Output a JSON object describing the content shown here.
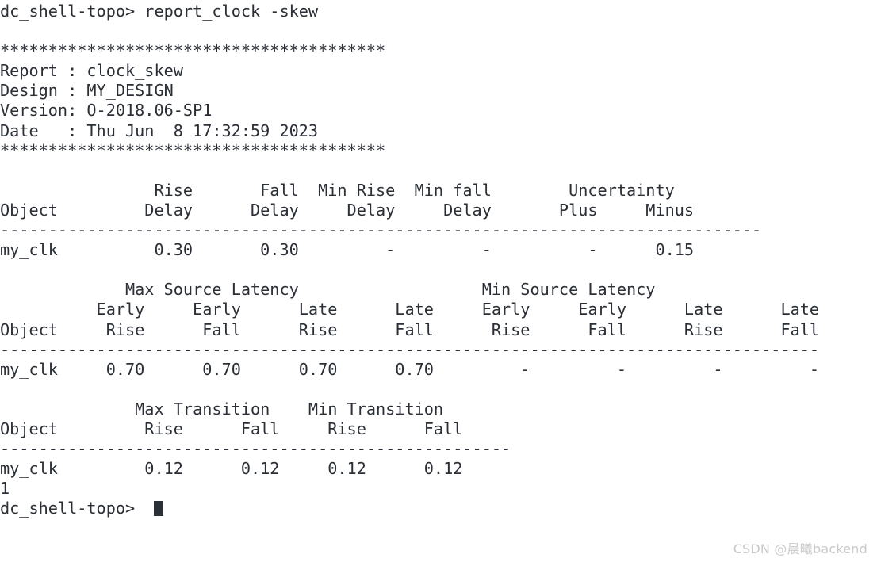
{
  "terminal": {
    "prompt": "dc_shell-topo> ",
    "command": "report_clock -skew",
    "separator": "****************************************",
    "report_header": {
      "report_label": "Report : ",
      "report_value": "clock_skew",
      "design_label": "Design : ",
      "design_value": "MY_DESIGN",
      "version_label": "Version: ",
      "version_value": "O-2018.06-SP1",
      "date_label": "Date   : ",
      "date_value": "Thu Jun  8 17:32:59 2023"
    },
    "table1": {
      "group_header_row": "               Rise        Fall  Min Rise  Min fall       Uncertainty",
      "header_row1": "               Rise        Fall  Min Rise  Min fall       Uncertainty",
      "header_row2": "Object        Delay       Delay     Delay     Delay      Plus     Minus",
      "divider": "------------------------------------------------------------------------------",
      "data_row": "my_clk         0.30        0.30         -         -         -      0.15",
      "object": "my_clk",
      "columns": [
        "Object",
        "Rise Delay",
        "Fall Delay",
        "Min Rise Delay",
        "Min fall Delay",
        "Uncertainty Plus",
        "Uncertainty Minus"
      ],
      "values": [
        "0.30",
        "0.30",
        "-",
        "-",
        "-",
        "0.15"
      ]
    },
    "table2": {
      "header_row1": "            Max Source Latency                  Min Source Latency",
      "header_row2": "          Early     Early      Late      Late     Early     Early      Late      Late",
      "header_row3": "Object     Rise      Fall      Rise      Fall      Rise      Fall      Rise      Fall",
      "divider": "------------------------------------------------------------------------------",
      "data_row": "my_clk     0.70      0.70      0.70      0.70         -         -         -         -",
      "object": "my_clk",
      "columns": [
        "Object",
        "Max Early Rise",
        "Max Early Fall",
        "Max Late Rise",
        "Max Late Fall",
        "Min Early Rise",
        "Min Early Fall",
        "Min Late Rise",
        "Min Late Fall"
      ],
      "values": [
        "0.70",
        "0.70",
        "0.70",
        "0.70",
        "-",
        "-",
        "-",
        "-"
      ]
    },
    "table3": {
      "header_row1": "              Max Transition    Min Transition",
      "header_row2": "Object        Rise      Fall    Rise      Fall",
      "divider": "------------------------------------------------------",
      "data_row": "my_clk        0.12      0.12    0.12      0.12",
      "object": "my_clk",
      "columns": [
        "Object",
        "Max Rise",
        "Max Fall",
        "Min Rise",
        "Min Fall"
      ],
      "values": [
        "0.12",
        "0.12",
        "0.12",
        "0.12"
      ]
    },
    "return_value": "1",
    "final_prompt": "dc_shell-topo> ",
    "full_text": "dc_shell-topo> report_clock -skew\n\n****************************************\nReport : clock_skew\nDesign : MY_DESIGN\nVersion: O-2018.06-SP1\nDate   : Thu Jun  8 17:32:59 2023\n****************************************\n\n                Rise       Fall  Min Rise  Min fall        Uncertainty\nObject         Delay      Delay     Delay     Delay       Plus     Minus\n-------------------------------------------------------------------------------\nmy_clk          0.30       0.30         -         -          -      0.15\n\n             Max Source Latency                   Min Source Latency\n          Early     Early      Late      Late     Early     Early      Late      Late\nObject     Rise      Fall      Rise      Fall      Rise      Fall      Rise      Fall\n-------------------------------------------------------------------------------------\nmy_clk     0.70      0.70      0.70      0.70         -         -         -         -\n\n              Max Transition    Min Transition\nObject         Rise      Fall     Rise      Fall\n-----------------------------------------------------\nmy_clk         0.12      0.12     0.12      0.12\n1\ndc_shell-topo> "
  },
  "watermark": {
    "text": "CSDN @晨曦backend"
  },
  "colors": {
    "background": "#ffffff",
    "text": "#2b2f36",
    "watermark": "#c9c9c9"
  }
}
